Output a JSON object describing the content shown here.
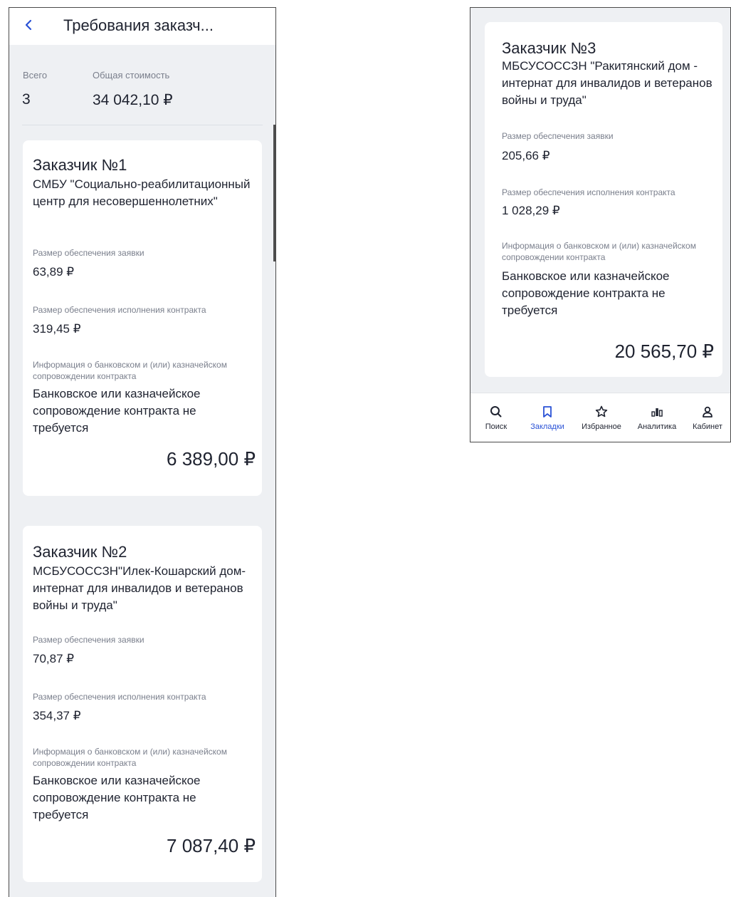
{
  "header": {
    "title": "Требования заказч..."
  },
  "summary": {
    "total_label": "Всего",
    "total_value": "3",
    "cost_label": "Общая стоимость",
    "cost_value": "34 042,10 ₽"
  },
  "labels": {
    "application_security": "Размер обеспечения заявки",
    "contract_security": "Размер обеспечения исполнения контракта",
    "bank_info": "Информация о банковском и (или) казначейском сопровождении контракта"
  },
  "customers": [
    {
      "title": "Заказчик №1",
      "org": "СМБУ \"Социально-реабилитационный центр для несовершеннолетних\"",
      "application_security": "63,89 ₽",
      "contract_security": "319,45 ₽",
      "bank_info": "Банковское или казначейское сопровождение контракта не требуется",
      "total": "6 389,00 ₽"
    },
    {
      "title": "Заказчик №2",
      "org": "МСБУСОССЗН\"Илек-Кошарский дом-интернат для инвалидов и ветеранов войны и труда\"",
      "application_security": "70,87 ₽",
      "contract_security": "354,37 ₽",
      "bank_info": "Банковское или казначейское сопровождение контракта не требуется",
      "total": "7 087,40 ₽"
    },
    {
      "title": "Заказчик №3",
      "org": "МБСУСОССЗН \"Ракитянский дом - интернат для инвалидов и ветеранов войны и труда\"",
      "application_security": "205,66 ₽",
      "contract_security": "1 028,29 ₽",
      "bank_info": "Банковское или казначейское сопровождение контракта не требуется",
      "total": "20 565,70 ₽"
    }
  ],
  "tabbar": {
    "items": [
      {
        "label": "Поиск",
        "icon": "search-icon"
      },
      {
        "label": "Закладки",
        "icon": "bookmark-icon",
        "active": true
      },
      {
        "label": "Избранное",
        "icon": "star-icon"
      },
      {
        "label": "Аналитика",
        "icon": "analytics-icon"
      },
      {
        "label": "Кабинет",
        "icon": "user-icon"
      }
    ],
    "active_color": "#2a52d6"
  }
}
